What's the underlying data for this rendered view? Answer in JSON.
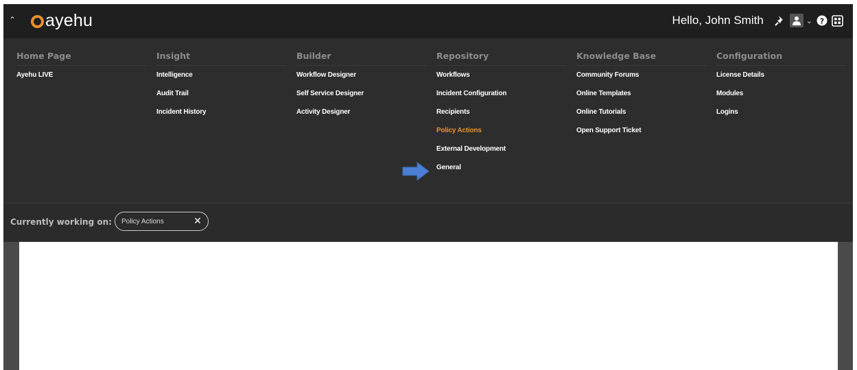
{
  "header": {
    "brand": "ayehu",
    "greeting": "Hello, John Smith",
    "icons": [
      "chevron-up-icon",
      "pin-icon",
      "user-icon",
      "chevron-down-icon",
      "help-icon",
      "grid-icon"
    ]
  },
  "menu": {
    "columns": [
      {
        "title": "Home Page",
        "items": [
          "Ayehu LIVE"
        ]
      },
      {
        "title": "Insight",
        "items": [
          "Intelligence",
          "Audit Trail",
          "Incident History"
        ]
      },
      {
        "title": "Builder",
        "items": [
          "Workflow Designer",
          "Self Service Designer",
          "Activity Designer"
        ]
      },
      {
        "title": "Repository",
        "items": [
          "Workflows",
          "Incident Configuration",
          "Recipients",
          "Policy Actions",
          "External Development",
          "General"
        ]
      },
      {
        "title": "Knowledge Base",
        "items": [
          "Community Forums",
          "Online Templates",
          "Online Tutorials",
          "Open Support Ticket"
        ]
      },
      {
        "title": "Configuration",
        "items": [
          "License Details",
          "Modules",
          "Logins"
        ]
      }
    ],
    "active_item": "Policy Actions"
  },
  "working": {
    "label": "Currently working on:",
    "chip_label": "Policy Actions",
    "chip_close": "✕"
  },
  "colors": {
    "accent": "#e8922b",
    "arrow": "#4a7fd4",
    "topbar": "#1f1f1f",
    "menu_bg": "#2d2d2d"
  }
}
